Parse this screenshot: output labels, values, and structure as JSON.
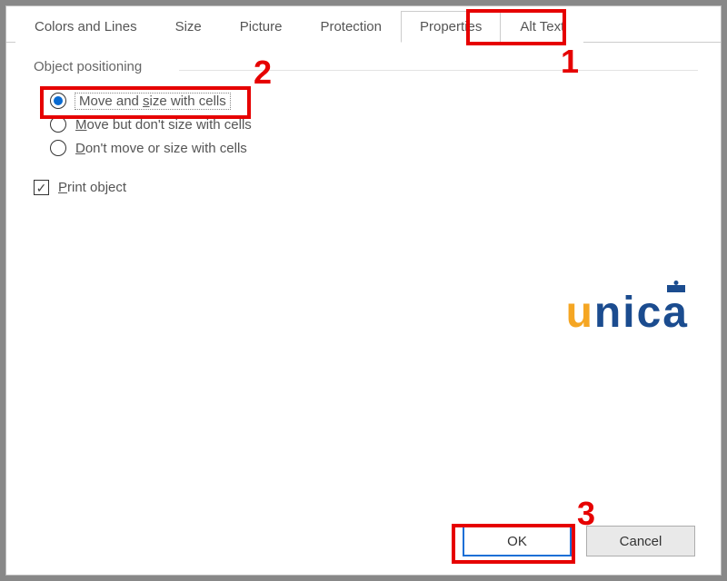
{
  "tabs": {
    "colors": "Colors and Lines",
    "size": "Size",
    "picture": "Picture",
    "protection": "Protection",
    "properties": "Properties",
    "alttext": "Alt Text"
  },
  "section": {
    "title": "Object positioning"
  },
  "radios": {
    "opt1_pre": "Move and ",
    "opt1_u": "s",
    "opt1_post": "ize with cells",
    "opt2_u": "M",
    "opt2_post": "ove but don't size with cells",
    "opt3_u": "D",
    "opt3_post": "on't move or size with cells",
    "selected": "move_and_size"
  },
  "checkbox": {
    "print_u": "P",
    "print_post": "rint object",
    "checked": true
  },
  "buttons": {
    "ok": "OK",
    "cancel": "Cancel"
  },
  "annotations": {
    "n1": "1",
    "n2": "2",
    "n3": "3"
  },
  "logo": {
    "u": "u",
    "n": "n",
    "i": "i",
    "c": "c",
    "a": "a"
  }
}
